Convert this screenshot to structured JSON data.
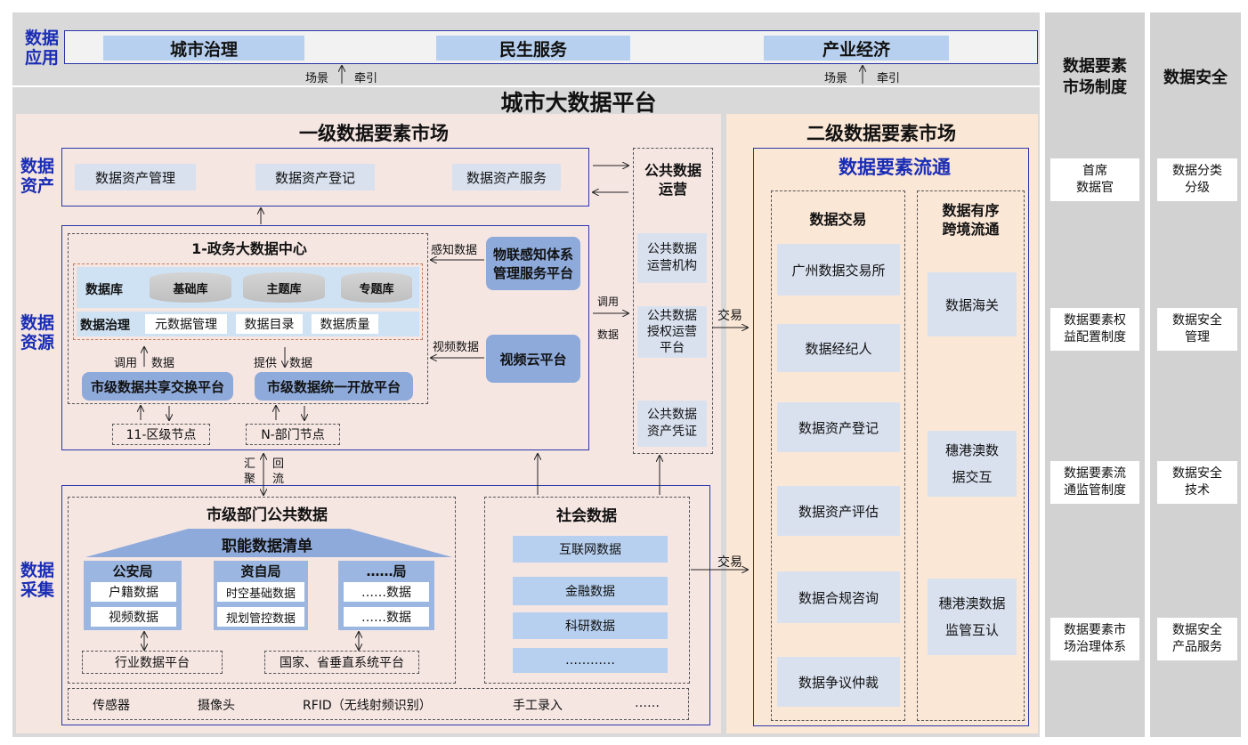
{
  "apps": {
    "side_label": "数据\n应用",
    "items": [
      "城市治理",
      "民生服务",
      "产业经济"
    ],
    "traction_left": "场景",
    "traction_left2": "牵引",
    "traction_right": "场景",
    "traction_right2": "牵引"
  },
  "platform_title": "城市大数据平台",
  "market1": {
    "title": "一级数据要素市场",
    "asset_label": "数据\n资产",
    "assets": [
      "数据资产管理",
      "数据资产登记",
      "数据资产服务"
    ],
    "resource_label": "数据\n资源",
    "center_title": "1-政务大数据中心",
    "db_label": "数据库",
    "dbs": [
      "基础库",
      "主题库",
      "专题库"
    ],
    "gov_label": "数据治理",
    "gov_items": [
      "元数据管理",
      "数据目录",
      "数据质量"
    ],
    "call_label": "调用",
    "data_label": "数据",
    "provide_label": "提供",
    "data_label2": "数据",
    "share_platform": "市级数据共享交换平台",
    "open_platform": "市级数据统一开放平台",
    "sense_data": "感知数据",
    "video_data": "视频数据",
    "iot_platform": "物联感知体系管理服务平台",
    "video_platform": "视频云平台",
    "district_node": "11-区级节点",
    "dept_node": "N-部门节点",
    "gather": "汇\n聚",
    "flow_back": "回\n流",
    "collect_label": "数据\n采集",
    "dept_public_title": "市级部门公共数据",
    "duty_list": "职能数据清单",
    "bureaus": [
      {
        "name": "公安局",
        "items": [
          "户籍数据",
          "视频数据"
        ]
      },
      {
        "name": "资自局",
        "items": [
          "时空基础数据",
          "规划管控数据"
        ]
      },
      {
        "name": "……局",
        "items": [
          "……数据",
          "……数据"
        ]
      }
    ],
    "industry_platform": "行业数据平台",
    "national_platform": "国家、省垂直系统平台",
    "social_title": "社会数据",
    "social_items": [
      "互联网数据",
      "金融数据",
      "科研数据",
      "…………"
    ],
    "sources": [
      "传感器",
      "摄像头",
      "RFID（无线射频识别）",
      "手工录入",
      "……"
    ]
  },
  "public_ops": {
    "title": "公共数据\n运营",
    "items": [
      "公共数据\n运营机构",
      "公共数据\n授权运营\n平台",
      "公共数据\n资产凭证"
    ],
    "call": "调用",
    "data": "数据",
    "trade": "交易",
    "trade2": "交易"
  },
  "market2": {
    "title": "二级数据要素市场",
    "flow_title": "数据要素流通",
    "trade_title": "数据交易",
    "trade_items": [
      "广州数据交易所",
      "数据经纪人",
      "数据资产登记",
      "数据资产评估",
      "数据合规咨询",
      "数据争议仲裁"
    ],
    "cross_title": "数据有序\n跨境流通",
    "cross_items": [
      "数据海关",
      "穗港澳数\n据交互",
      "穗港澳数据\n监管互认"
    ]
  },
  "system": {
    "title": "数据要素\n市场制度",
    "items": [
      "首席\n数据官",
      "数据要素权\n益配置制度",
      "数据要素流\n通监管制度",
      "数据要素市\n场治理体系"
    ]
  },
  "security": {
    "title": "数据安全",
    "items": [
      "数据分类\n分级",
      "数据安全\n管理",
      "数据安全\n技术",
      "数据安全\n产品服务"
    ]
  }
}
